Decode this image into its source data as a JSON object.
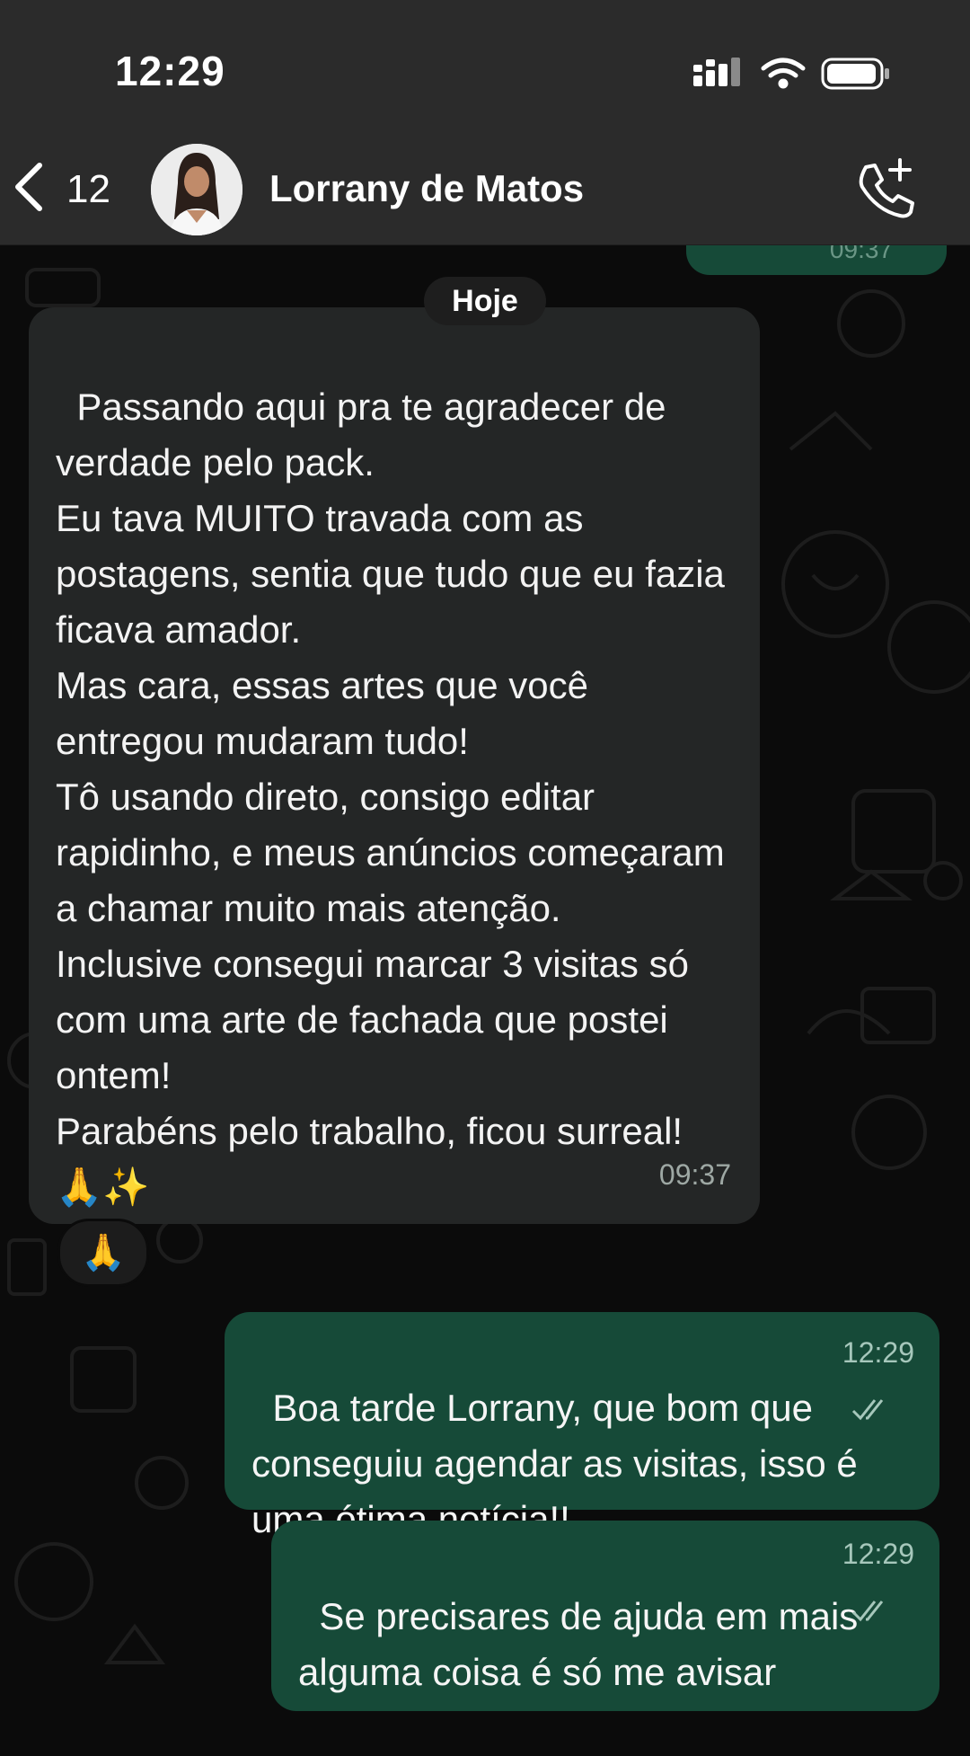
{
  "status_bar": {
    "time": "12:29"
  },
  "header": {
    "back_count": "12",
    "contact_name": "Lorrany de Matos",
    "icons": [
      "chevron-left-icon",
      "phone-add-icon",
      "signal-icon",
      "wifi-icon",
      "battery-icon"
    ]
  },
  "prev_message": {
    "time": "09:37"
  },
  "day_separator": "Hoje",
  "messages": [
    {
      "direction": "incoming",
      "text": "Passando aqui pra te agradecer de verdade pelo pack.\nEu tava MUITO travada com as postagens, sentia que tudo que eu fazia ficava amador.\nMas cara, essas artes que você entregou mudaram tudo!\nTô usando direto, consigo editar rapidinho, e meus anúncios começaram a chamar muito mais atenção.\nInclusive consegui marcar 3 visitas só com uma arte de fachada que postei ontem!\nParabéns pelo trabalho, ficou surreal! 🙏✨",
      "time": "09:37",
      "reaction": "🙏"
    },
    {
      "direction": "outgoing",
      "text": "Boa tarde Lorrany, que bom que conseguiu agendar as visitas, isso é uma ótima notícia!!",
      "time": "12:29",
      "status": "read"
    },
    {
      "direction": "outgoing",
      "text": "Se precisares de ajuda em mais alguma coisa é só me avisar",
      "time": "12:29",
      "status": "read"
    }
  ],
  "colors": {
    "header_bg": "#2b2b2b",
    "incoming_bubble": "#242626",
    "outgoing_bubble": "#164a38",
    "background": "#0b0b0b"
  }
}
